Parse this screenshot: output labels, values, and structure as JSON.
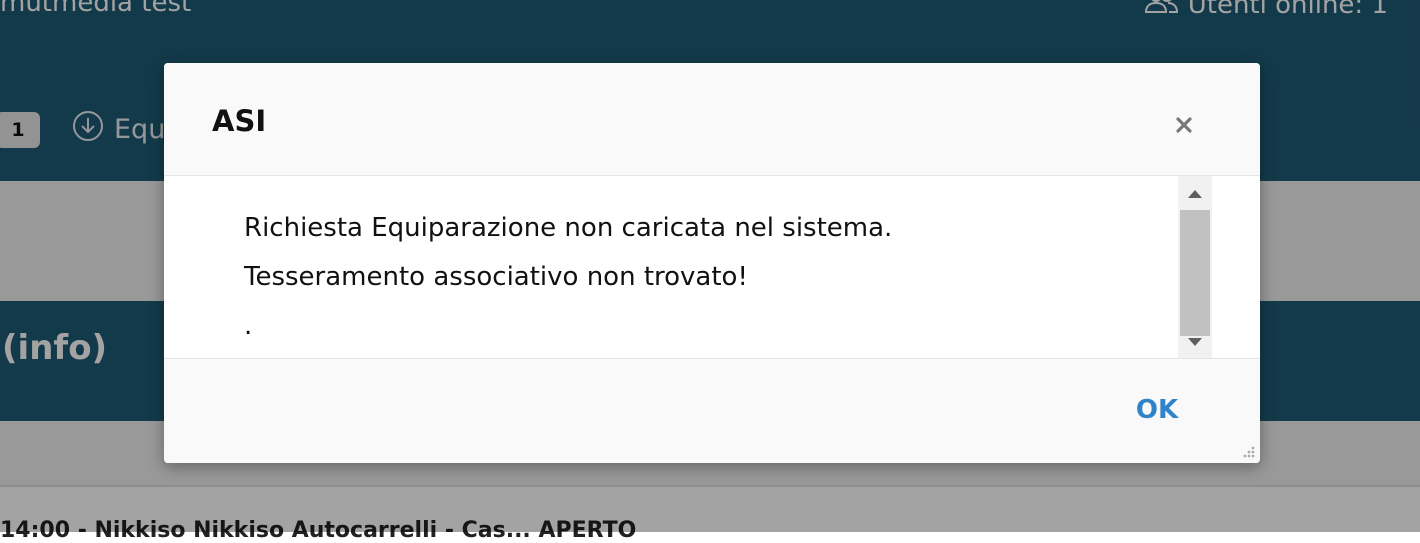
{
  "background": {
    "app_title": "mutmedia test",
    "users_online": "Utenti online: 1",
    "badge_count": "1",
    "equip_label": "Equ",
    "info_heading": "(info)",
    "bottom_text": "14:00 - Nikkiso Nikkiso Autocarrelli - Cas... APERTO",
    "colors": {
      "topbar": "#1f5b75",
      "grey_band": "#f0f0f0"
    }
  },
  "dialog": {
    "title": "ASI",
    "message_lines": [
      "Richiesta Equiparazione non caricata nel sistema.",
      "Tesseramento associativo non trovato!",
      "."
    ],
    "ok_label": "OK",
    "close_icon": "close-icon",
    "colors": {
      "ok": "#2f84c9",
      "header_bg": "#f9f9f9"
    }
  }
}
